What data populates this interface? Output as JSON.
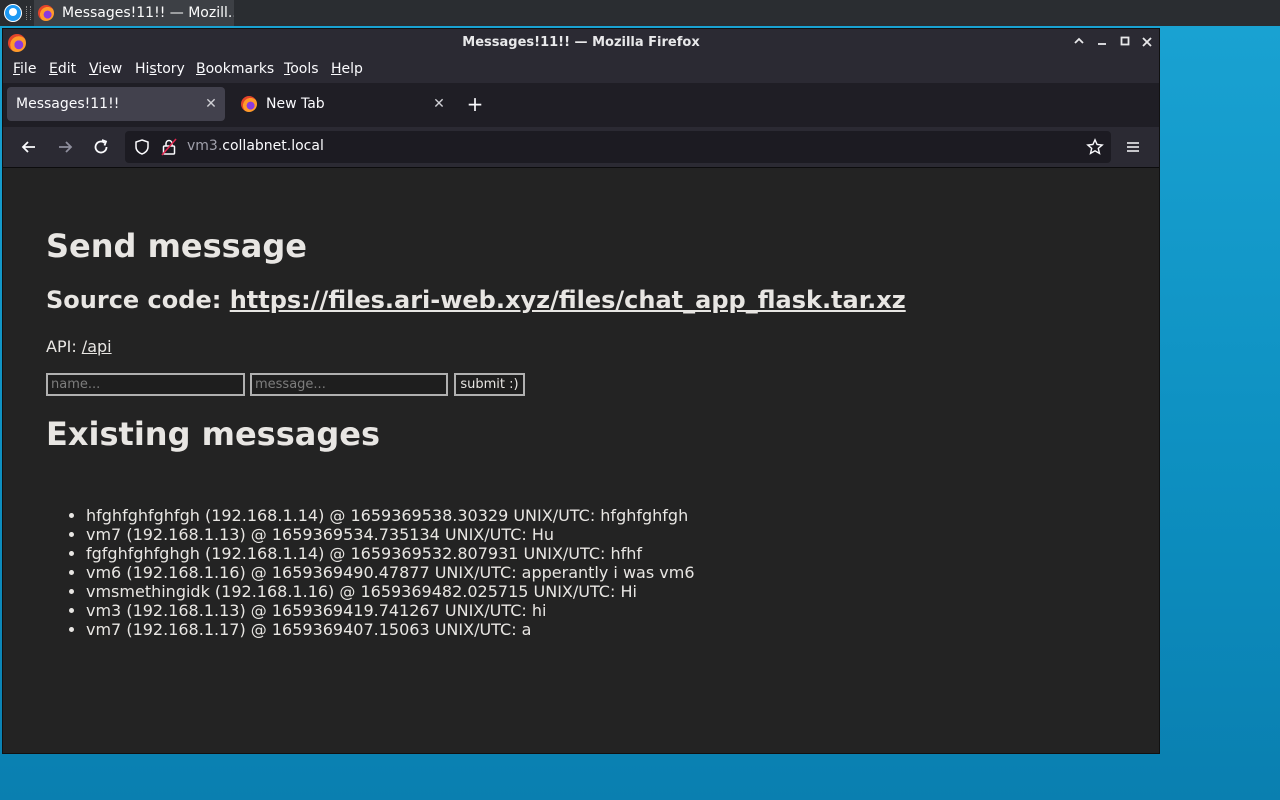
{
  "taskbar": {
    "task_title": "Messages!11!! — Mozill..."
  },
  "window": {
    "title": "Messages!11!! — Mozilla Firefox"
  },
  "menubar": {
    "items": [
      {
        "label": "File",
        "u": "F",
        "rest": "ile"
      },
      {
        "label": "Edit",
        "u": "E",
        "rest": "dit"
      },
      {
        "label": "View",
        "u": "V",
        "rest": "iew"
      },
      {
        "label": "History",
        "pre": "Hi",
        "u": "s",
        "rest": "tory"
      },
      {
        "label": "Bookmarks",
        "u": "B",
        "rest": "ookmarks"
      },
      {
        "label": "Tools",
        "u": "T",
        "rest": "ools"
      },
      {
        "label": "Help",
        "u": "H",
        "rest": "elp"
      }
    ]
  },
  "tabs": [
    {
      "label": "Messages!11!!",
      "active": true
    },
    {
      "label": "New Tab",
      "active": false
    }
  ],
  "urlbar": {
    "host_prefix": "vm3.",
    "host_main": "collabnet.local"
  },
  "page": {
    "heading": "Send message",
    "source_label": "Source code: ",
    "source_link": "https://files.ari-web.xyz/files/chat_app_flask.tar.xz",
    "api_label": "API: ",
    "api_link": "/api",
    "form": {
      "name_placeholder": "name...",
      "message_placeholder": "message...",
      "submit_label": "submit :)"
    },
    "existing_heading": "Existing messages",
    "messages": [
      "hfghfghfghfgh (192.168.1.14) @ 1659369538.30329 UNIX/UTC: hfghfghfgh",
      "vm7 (192.168.1.13) @ 1659369534.735134 UNIX/UTC: Hu",
      "fgfghfghfghgh (192.168.1.14) @ 1659369532.807931 UNIX/UTC: hfhf",
      "vm6 (192.168.1.16) @ 1659369490.47877 UNIX/UTC: apperantly i was vm6",
      "vmsmethingidk (192.168.1.16) @ 1659369482.025715 UNIX/UTC: Hi",
      "vm3 (192.168.1.13) @ 1659369419.741267 UNIX/UTC: hi",
      "vm7 (192.168.1.17) @ 1659369407.15063 UNIX/UTC: a"
    ]
  }
}
